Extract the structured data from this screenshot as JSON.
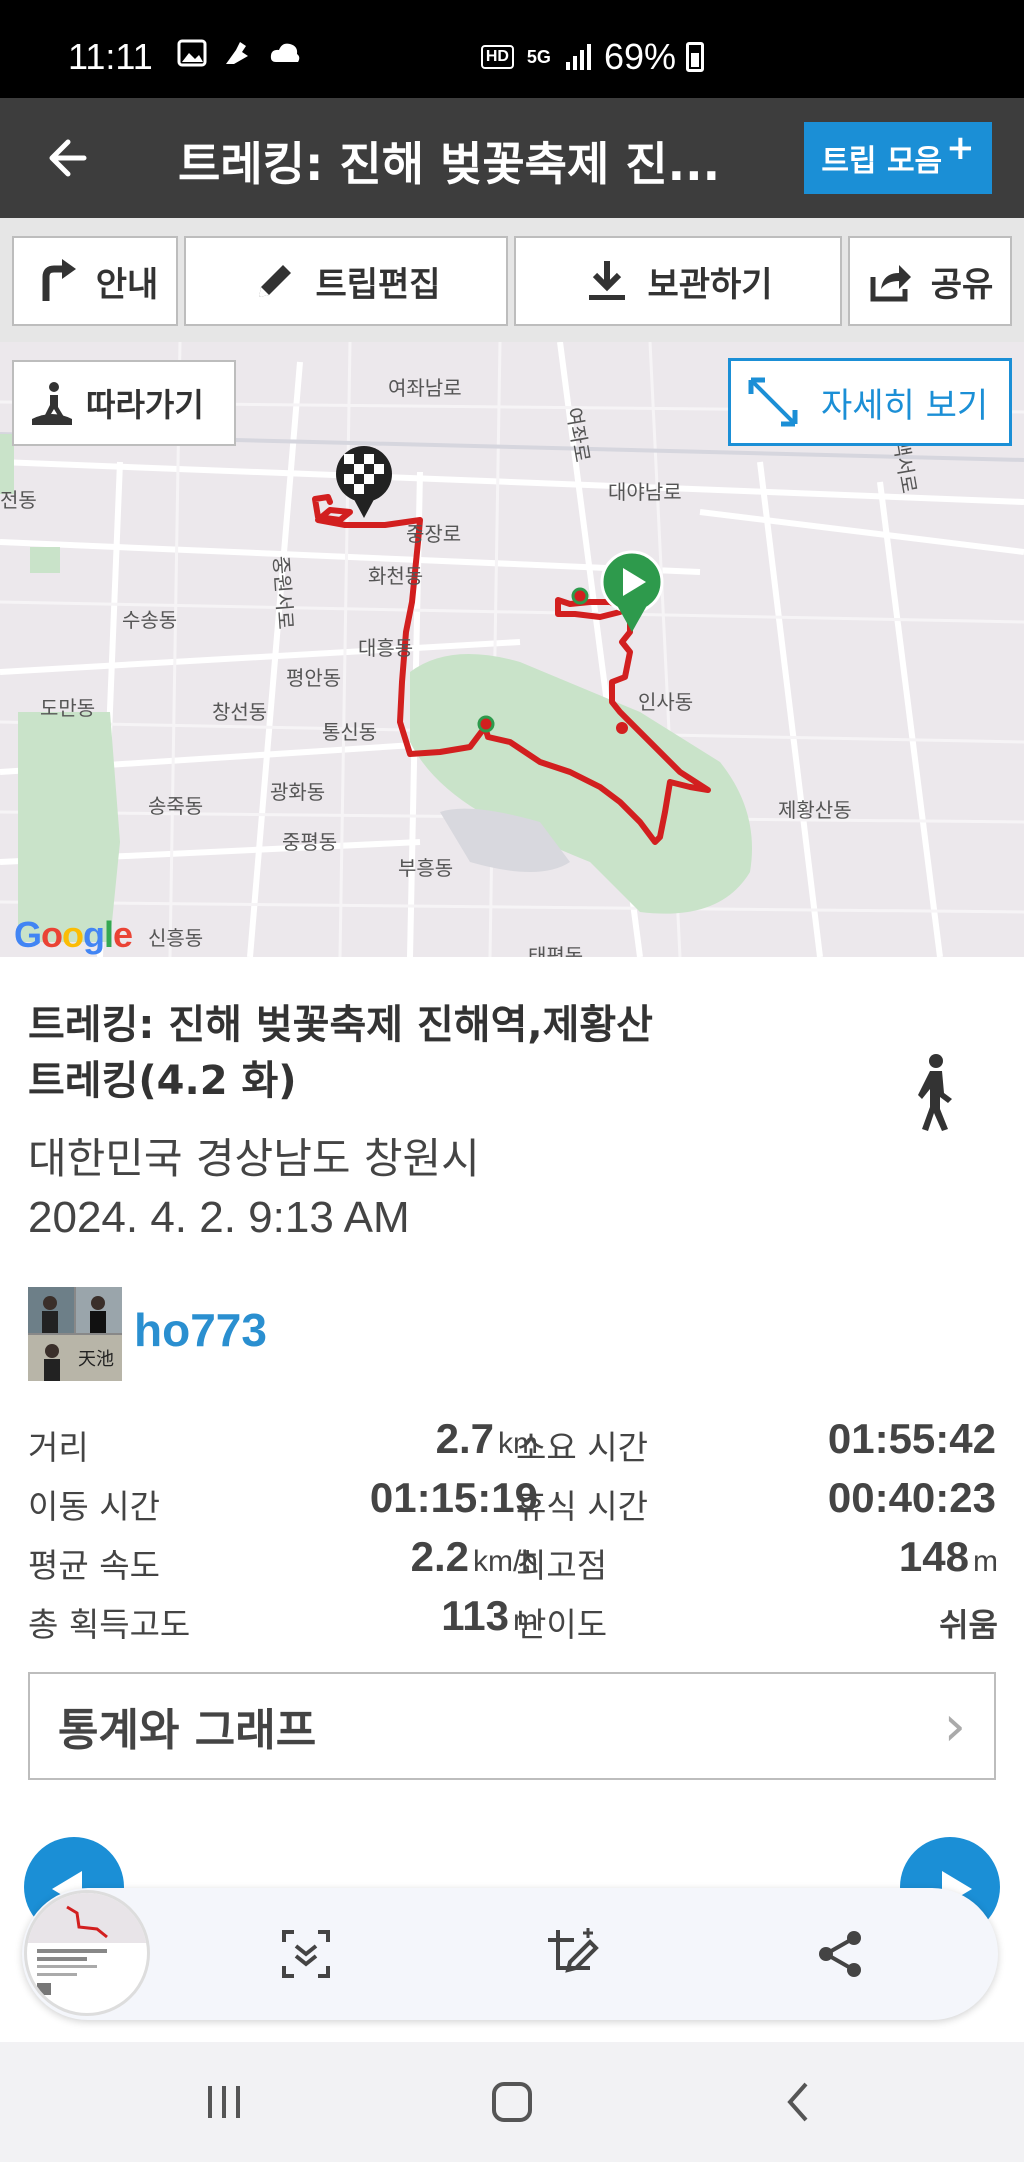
{
  "status": {
    "time": "11:11",
    "hd": "HD",
    "network": "5G",
    "battery": "69%"
  },
  "header": {
    "title": "트레킹: 진해 벚꽃축제 진...",
    "trip_button": "트립 모음",
    "trip_button_plus": "+"
  },
  "toolbar": {
    "guide": "안내",
    "edit": "트립편집",
    "save": "보관하기",
    "share": "공유"
  },
  "map": {
    "follow": "따라가기",
    "detail": "자세히 보기",
    "google": "Google",
    "labels": [
      "여좌남로",
      "여좌로",
      "대야남로",
      "태백서로",
      "전동",
      "중장로",
      "화천동",
      "수송동",
      "대흥동",
      "중원서로",
      "평안동",
      "도만동",
      "창선동",
      "통신동",
      "인사동",
      "제황산동",
      "송죽동",
      "광화동",
      "중평동",
      "부흥동",
      "신흥동",
      "태평동"
    ]
  },
  "trip": {
    "title_line1": "트레킹: 진해 벚꽃축제 진해역,제황산",
    "title_line2": "트레킹(4.2 화)",
    "location": "대한민국 경상남도 창원시",
    "datetime": "2024. 4. 2. 9:13 AM",
    "user": "ho773",
    "activity_icon": "walking-person-icon"
  },
  "stats": {
    "distance_label": "거리",
    "distance_value": "2.7",
    "distance_unit": "km",
    "total_time_label": "소요 시간",
    "total_time_value": "01:55:42",
    "moving_time_label": "이동 시간",
    "moving_time_value": "01:15:19",
    "rest_time_label": "휴식 시간",
    "rest_time_value": "00:40:23",
    "avg_speed_label": "평균 속도",
    "avg_speed_value": "2.2",
    "avg_speed_unit": "km/h",
    "max_alt_label": "최고점",
    "max_alt_value": "148",
    "max_alt_unit": "m",
    "gain_label": "총 획득고도",
    "gain_value": "113",
    "gain_unit": "m",
    "difficulty_label": "난이도",
    "difficulty_value": "쉬움"
  },
  "stats_button": "통계와 그래프",
  "colors": {
    "accent": "#1b8fd6",
    "header_bg": "#3d3d3d",
    "route": "#d21f1f",
    "start_marker": "#2e9a4c"
  }
}
